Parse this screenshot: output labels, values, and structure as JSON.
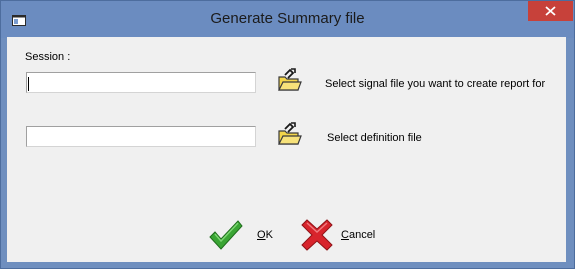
{
  "window": {
    "title": "Generate Summary file"
  },
  "session": {
    "label": "Session :",
    "signal_value": "",
    "signal_hint": "Select signal file you want to create report for",
    "definition_value": "",
    "definition_hint": "Select definition file"
  },
  "buttons": {
    "ok": {
      "accel": "O",
      "rest": "K",
      "icon": "green-check-icon"
    },
    "cancel": {
      "accel": "C",
      "rest": "ancel",
      "icon": "red-x-icon"
    }
  },
  "colors": {
    "titlebar": "#6b8cc0",
    "close": "#c7413a",
    "client": "#f0f0f0",
    "ok_green": "#3aa534",
    "cancel_red": "#d8242c",
    "folder_yellow": "#f3d54a"
  }
}
